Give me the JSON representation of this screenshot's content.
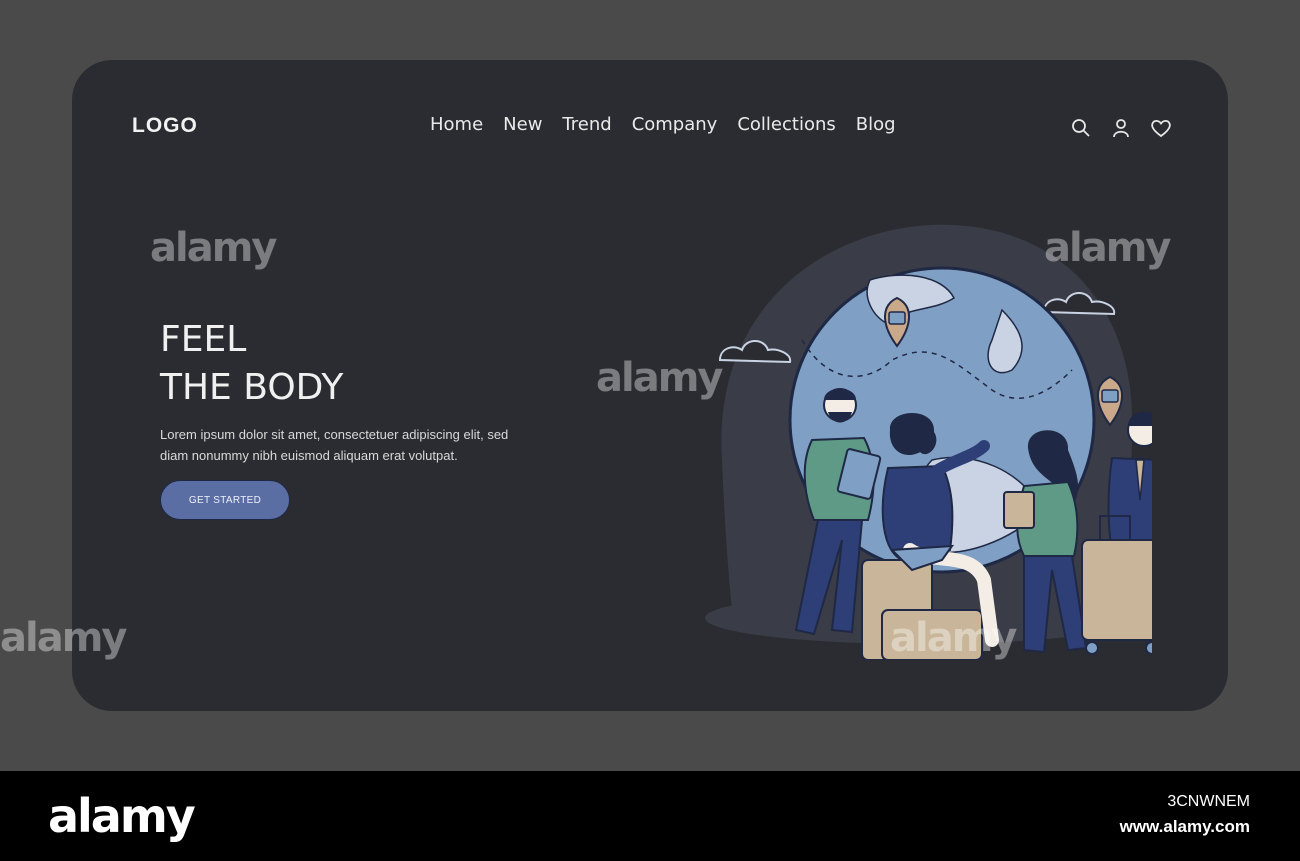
{
  "header": {
    "logo": "LOGO",
    "nav": [
      "Home",
      "New",
      "Trend",
      "Company",
      "Collections",
      "Blog"
    ],
    "icons": [
      "search-icon",
      "user-icon",
      "heart-icon"
    ]
  },
  "hero": {
    "title_line1": "FEEL",
    "title_line2": "THE BODY",
    "body": "Lorem ipsum dolor sit amet, consectetuer adipiscing elit, sed diam nonummy nibh euismod aliquam erat volutpat.",
    "cta": "GET STARTED"
  },
  "footer": {
    "brand": "alamy",
    "image_id": "3CNWNEM",
    "site": "www.alamy.com"
  },
  "watermark": "alamy",
  "colors": {
    "page_bg": "#4a4a4b",
    "card_bg": "#2b2c31",
    "cta_bg": "#5a6ea3",
    "globe": "#7f9fc4",
    "accent_dark": "#2e3f78"
  }
}
